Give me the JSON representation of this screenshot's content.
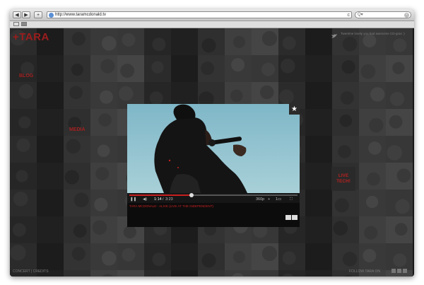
{
  "browser": {
    "back_label": "◀",
    "forward_label": "▶",
    "add_label": "+",
    "url": "http://www.taramcdonald.tv",
    "reload_label": "c",
    "search_placeholder": "Q▾",
    "search_clear": "×"
  },
  "site": {
    "logo": "+TARA",
    "nav": {
      "blog": "BLOG",
      "media": "MEDIA"
    },
    "tweet": "Tweetme lovely you had awesome CD-gras :)",
    "live": {
      "line1": "LIVE",
      "line2": "TECH!"
    },
    "footer_left": "CONCERT | CREDITS",
    "footer_right": "FOLLOW TARA ON"
  },
  "player": {
    "current_time": "1:14",
    "duration": "3:23",
    "progress_fraction": 0.37,
    "quality": "360p",
    "caption": "TARA MCDONALD - ALIVE (LIVE AT THE INDEPENDENT)",
    "controls": {
      "play": "❚❚",
      "volume": "◀)",
      "plus": "+",
      "ratio": "1▭",
      "fullscreen": "⛶"
    },
    "star": "★"
  },
  "colors": {
    "accent_red": "#c62020",
    "dark_bg": "#1f1f1f"
  }
}
